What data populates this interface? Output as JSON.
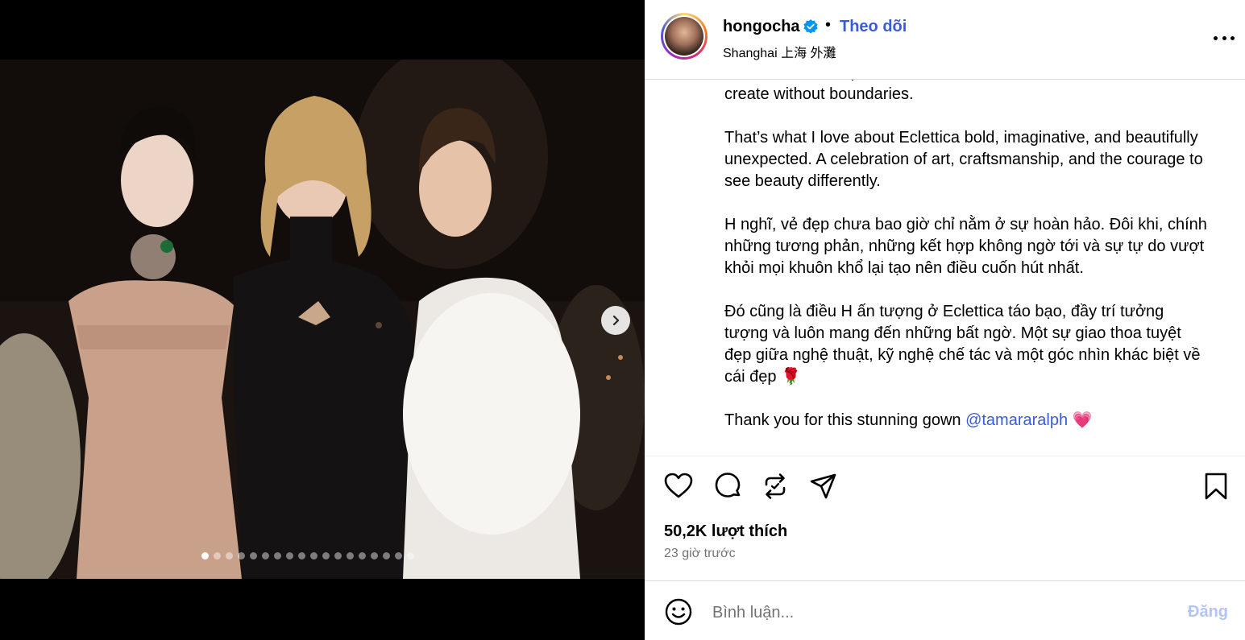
{
  "post": {
    "username": "hongocha",
    "verified_icon": "verified-badge-icon",
    "separator": "•",
    "follow_label": "Theo dõi",
    "location": "Shanghai 上海 外灘",
    "more_icon": "more-horizontal-icon"
  },
  "media": {
    "next_icon": "chevron-right-icon",
    "slide_count": 18,
    "active_slide": 1
  },
  "caption": {
    "paragraphs": [
      "contrasts, in unexpected combinations, and in the freedom to create without boundaries.",
      "That’s what I love about Eclettica bold, imaginative, and beautifully unexpected. A celebration of art, craftsmanship, and the courage to see beauty differently.",
      "H nghĩ, vẻ đẹp chưa bao giờ chỉ nằm ở sự hoàn hảo. Đôi khi, chính những tương phản, những kết hợp không ngờ tới và sự tự do vượt khỏi mọi khuôn khổ lại tạo nên điều cuốn hút nhất.",
      "Đó cũng là điều H ấn tượng ở Eclettica táo bạo, đầy trí tưởng tượng và luôn mang đến những bất ngờ. Một sự giao thoa tuyệt đẹp giữa nghệ thuật, kỹ nghệ chế tác và một góc nhìn khác biệt về cái đẹp 🌹"
    ],
    "last_text": "Thank you for this stunning gown ",
    "mention": "@tamararalph",
    "last_emoji": "💗"
  },
  "actions": {
    "like_icon": "heart-icon",
    "comment_icon": "comment-icon",
    "repost_icon": "repost-icon",
    "share_icon": "share-icon",
    "save_icon": "bookmark-icon"
  },
  "stats": {
    "likes": "50,2K lượt thích",
    "time": "23 giờ trước"
  },
  "comment": {
    "emoji_icon": "smile-icon",
    "placeholder": "Bình luận...",
    "post_label": "Đăng"
  }
}
